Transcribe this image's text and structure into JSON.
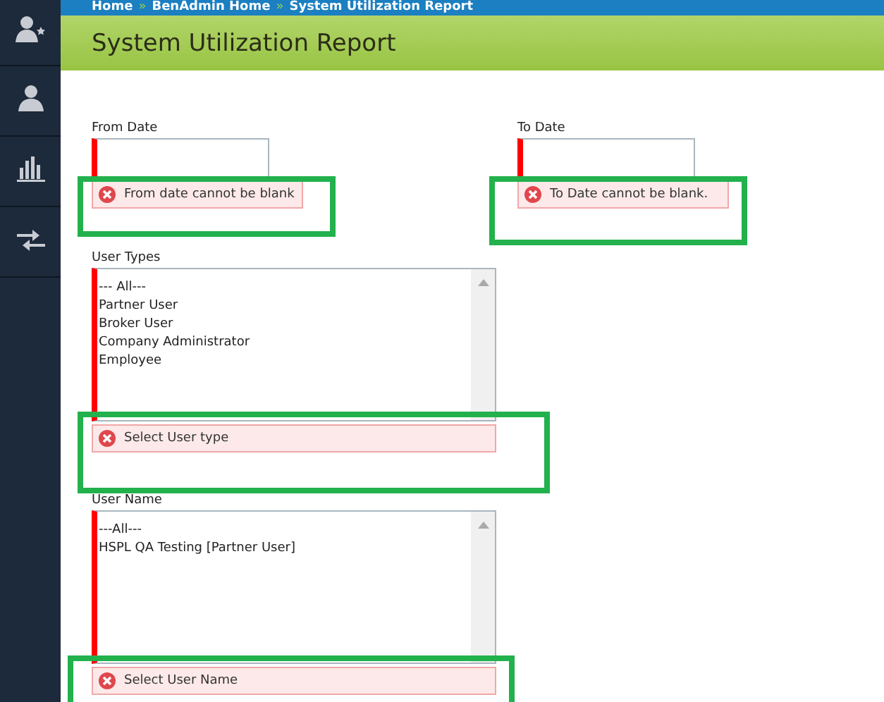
{
  "sidebar": {
    "items": [
      {
        "kind": "user-star"
      },
      {
        "kind": "user"
      },
      {
        "kind": "chart"
      },
      {
        "kind": "transfer"
      }
    ]
  },
  "breadcrumb": [
    "Home",
    "BenAdmin Home",
    "System Utilization Report"
  ],
  "breadcrumb_separator": "»",
  "page_title": "System Utilization Report",
  "date_fields": [
    {
      "label": "From Date",
      "error": "From date cannot be blank"
    },
    {
      "label": "To Date",
      "error": "To Date cannot be blank."
    }
  ],
  "list_fields": [
    {
      "label": "User Types",
      "options": [
        "--- All---",
        "Partner User",
        "Broker User",
        "Company Administrator",
        "Employee"
      ],
      "error": "Select User type"
    },
    {
      "label": "User Name",
      "options": [
        "---All---",
        "HSPL QA Testing [Partner User]"
      ],
      "error": "Select User Name"
    }
  ]
}
